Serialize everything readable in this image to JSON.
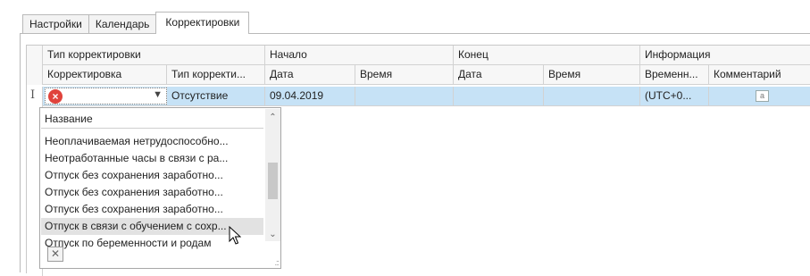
{
  "tabs": [
    {
      "label": "Настройки"
    },
    {
      "label": "Календарь"
    },
    {
      "label": "Корректировки"
    }
  ],
  "grid": {
    "bands": {
      "type": "Тип корректировки",
      "start": "Начало",
      "end": "Конец",
      "info": "Информация"
    },
    "columns": {
      "correction": "Корректировка",
      "correction_type": "Тип корректи...",
      "start_date": "Дата",
      "start_time": "Время",
      "end_date": "Дата",
      "end_time": "Время",
      "timezone": "Временн...",
      "comment": "Комментарий"
    },
    "row": {
      "row_indicator": "I",
      "status_icon": "error-icon",
      "correction_type": "Отсутствие",
      "start_date": "09.04.2019",
      "timezone": "(UTC+0...",
      "comment_icon": "note-icon",
      "comment_icon_text": "a"
    }
  },
  "dropdown": {
    "header": "Название",
    "items": [
      "Неоплачиваемая нетрудоспособно...",
      "Неотработанные часы в связи с ра...",
      "Отпуск без сохранения заработно...",
      "Отпуск без сохранения заработно...",
      "Отпуск без сохранения заработно...",
      "Отпуск в связи с обучением с сохр...",
      "Отпуск по беременности и родам"
    ],
    "highlighted_index": 5,
    "clear_label": "✕",
    "scroll_up": "⌃",
    "scroll_down": "⌄"
  },
  "colors": {
    "selection": "#c6e2f6",
    "error": "#e0433c"
  }
}
